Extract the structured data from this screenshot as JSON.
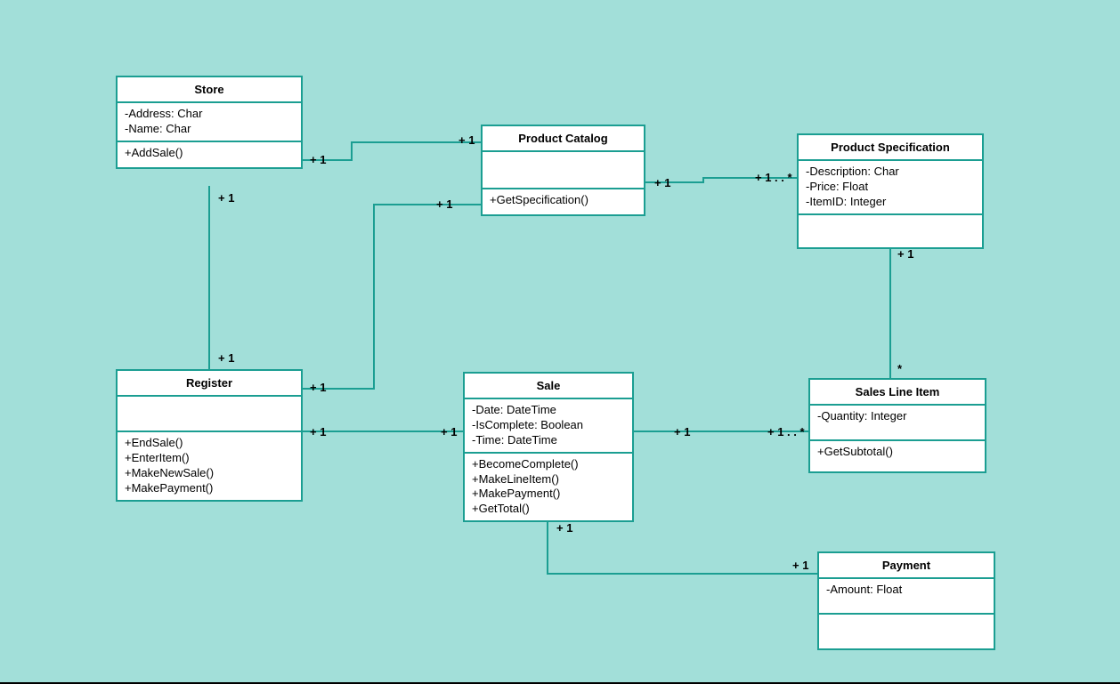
{
  "diagram_type": "UML Class Diagram",
  "classes": {
    "store": {
      "name": "Store",
      "attributes": [
        "-Address: Char",
        "-Name: Char"
      ],
      "operations": [
        "+AddSale()"
      ]
    },
    "productCatalog": {
      "name": "Product Catalog",
      "attributes": [],
      "operations": [
        "+GetSpecification()"
      ]
    },
    "productSpecification": {
      "name": "Product Specification",
      "attributes": [
        "-Description: Char",
        "-Price: Float",
        "-ItemID: Integer"
      ],
      "operations": []
    },
    "register": {
      "name": "Register",
      "attributes": [],
      "operations": [
        "+EndSale()",
        "+EnterItem()",
        "+MakeNewSale()",
        "+MakePayment()"
      ]
    },
    "sale": {
      "name": "Sale",
      "attributes": [
        "-Date: DateTime",
        "-IsComplete: Boolean",
        "-Time: DateTime"
      ],
      "operations": [
        "+BecomeComplete()",
        "+MakeLineItem()",
        "+MakePayment()",
        "+GetTotal()"
      ]
    },
    "salesLineItem": {
      "name": "Sales Line Item",
      "attributes": [
        "-Quantity: Integer"
      ],
      "operations": [
        "+GetSubtotal()"
      ]
    },
    "payment": {
      "name": "Payment",
      "attributes": [
        "-Amount: Float"
      ],
      "operations": []
    }
  },
  "multiplicities": {
    "store_catalog_left": "+ 1",
    "store_catalog_right": "+ 1",
    "store_register_top": "+ 1",
    "store_register_bottom": "+ 1",
    "catalog_spec_left": "+ 1",
    "catalog_spec_right": "+ 1 . . *",
    "register_catalog_left": "+ 1",
    "register_catalog_right": "+ 1",
    "register_sale_left": "+ 1",
    "register_sale_right": "+ 1",
    "sale_lineitem_left": "+ 1",
    "sale_lineitem_right": "+ 1 . . *",
    "spec_lineitem_top": "+ 1",
    "spec_lineitem_bottom": "*",
    "sale_payment_top": "+ 1",
    "sale_payment_right": "+ 1"
  },
  "associations": [
    {
      "from": "Store",
      "to": "Product Catalog",
      "from_mult": "+1",
      "to_mult": "+1"
    },
    {
      "from": "Store",
      "to": "Register",
      "from_mult": "+1",
      "to_mult": "+1"
    },
    {
      "from": "Product Catalog",
      "to": "Product Specification",
      "from_mult": "+1",
      "to_mult": "+1..*"
    },
    {
      "from": "Register",
      "to": "Product Catalog",
      "from_mult": "+1",
      "to_mult": "+1"
    },
    {
      "from": "Register",
      "to": "Sale",
      "from_mult": "+1",
      "to_mult": "+1"
    },
    {
      "from": "Sale",
      "to": "Sales Line Item",
      "from_mult": "+1",
      "to_mult": "+1..*"
    },
    {
      "from": "Product Specification",
      "to": "Sales Line Item",
      "from_mult": "+1",
      "to_mult": "*"
    },
    {
      "from": "Sale",
      "to": "Payment",
      "from_mult": "+1",
      "to_mult": "+1"
    }
  ]
}
